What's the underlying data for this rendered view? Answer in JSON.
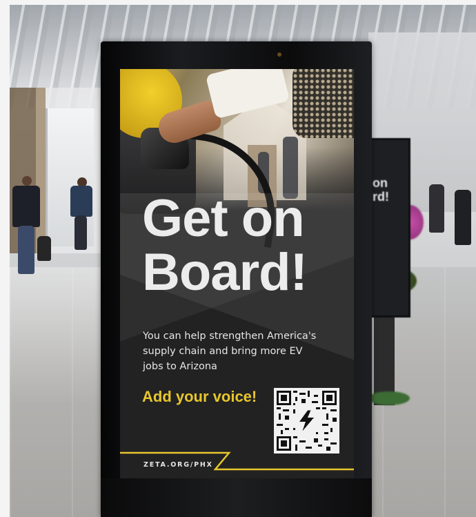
{
  "poster": {
    "headline": "Get on Board!",
    "headline_line1": "Get on",
    "headline_line2": "Board!",
    "body_line1": "You can help strengthen America's",
    "body_line2": "supply chain and bring more EV",
    "body_line3": "jobs to Arizona",
    "cta": "Add your voice!",
    "url": "ZETA.ORG/PHX",
    "qr_icon": "lightning-bolt-icon"
  },
  "background_sign": {
    "line1": "on",
    "line2": "rd!"
  },
  "colors": {
    "accent_yellow": "#e8c62c",
    "screen_dark": "#2a2a2b",
    "kiosk_frame": "#0b0b0c",
    "headline_text": "#ececec"
  }
}
